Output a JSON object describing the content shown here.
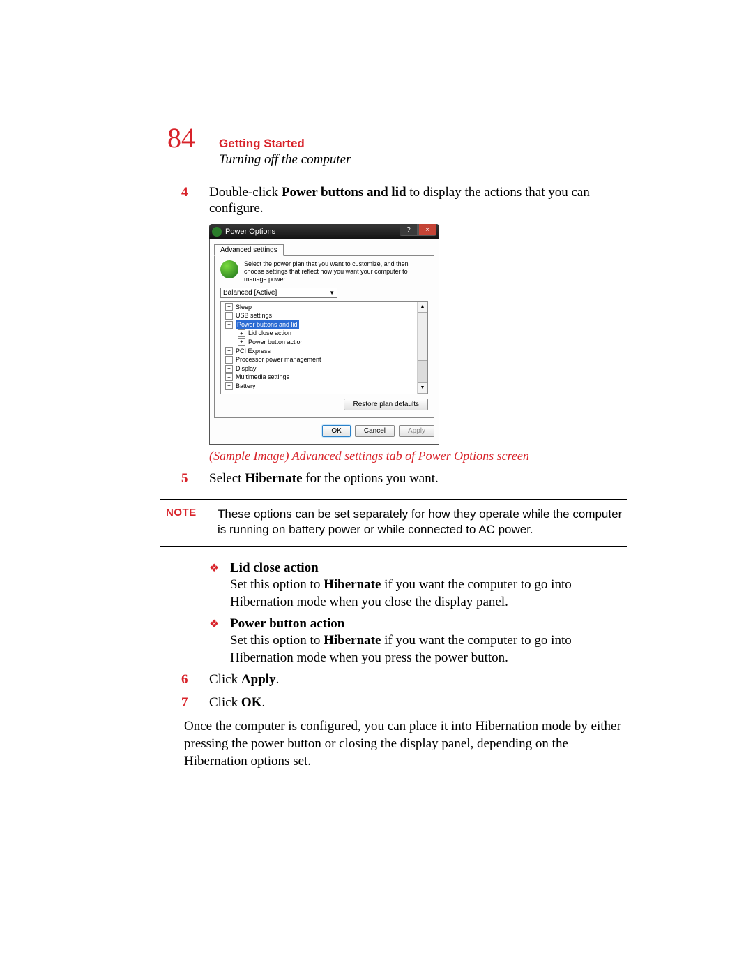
{
  "page_number": "84",
  "chapter": "Getting Started",
  "subtitle": "Turning off the computer",
  "steps": {
    "s4": {
      "num": "4",
      "pre": "Double-click ",
      "bold": "Power buttons and lid",
      "post": " to display the actions that you can configure."
    },
    "s5": {
      "num": "5",
      "pre": "Select ",
      "bold": "Hibernate",
      "post": " for the options you want."
    },
    "s6": {
      "num": "6",
      "pre": "Click ",
      "bold": "Apply",
      "post": "."
    },
    "s7": {
      "num": "7",
      "pre": "Click ",
      "bold": "OK",
      "post": "."
    }
  },
  "caption": "(Sample Image) Advanced settings tab of Power Options screen",
  "note": {
    "label": "NOTE",
    "text": "These options can be set separately for how they operate while the computer is running on battery power or while connected to AC power."
  },
  "bullets": {
    "b1": {
      "title": "Lid close action",
      "pre": "Set this option to ",
      "bold": "Hibernate",
      "post": " if you want the computer to go into Hibernation mode when you close the display panel."
    },
    "b2": {
      "title": "Power button action",
      "pre": "Set this option to ",
      "bold": "Hibernate",
      "post": " if you want the computer to go into Hibernation mode when you press the power button."
    }
  },
  "closing": "Once the computer is configured, you can place it into Hibernation mode by either pressing the power button or closing the display panel, depending on the Hibernation options set.",
  "dialog": {
    "title": "Power Options",
    "help": "?",
    "close": "×",
    "tab": "Advanced settings",
    "desc": "Select the power plan that you want to customize, and then choose settings that reflect how you want your computer to manage power.",
    "select": "Balanced [Active]",
    "tree": {
      "t0": "Sleep",
      "t1": "USB settings",
      "t2": "Power buttons and lid",
      "t2a": "Lid close action",
      "t2b": "Power button action",
      "t3": "PCI Express",
      "t4": "Processor power management",
      "t5": "Display",
      "t6": "Multimedia settings",
      "t7": "Battery"
    },
    "plus": "+",
    "minus": "−",
    "up": "▲",
    "down": "▼",
    "restore": "Restore plan defaults",
    "ok": "OK",
    "cancel": "Cancel",
    "apply": "Apply"
  }
}
